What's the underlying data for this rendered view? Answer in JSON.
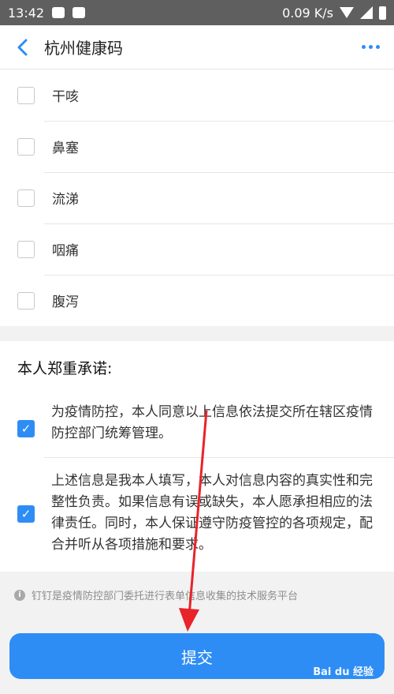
{
  "status_bar": {
    "time": "13:42",
    "speed": "0.09 K/s"
  },
  "nav": {
    "title": "杭州健康码"
  },
  "symptoms": [
    {
      "label": "干咳",
      "checked": false
    },
    {
      "label": "鼻塞",
      "checked": false
    },
    {
      "label": "流涕",
      "checked": false
    },
    {
      "label": "咽痛",
      "checked": false
    },
    {
      "label": "腹泻",
      "checked": false
    }
  ],
  "promise": {
    "title": "本人郑重承诺:",
    "items": [
      {
        "text": "为疫情防控，本人同意以上信息依法提交所在辖区疫情防控部门统筹管理。",
        "checked": true
      },
      {
        "text": "上述信息是我本人填写，本人对信息内容的真实性和完整性负责。如果信息有误或缺失，本人愿承担相应的法律责任。同时，本人保证遵守防疫管控的各项规定，配合并听从各项措施和要求。",
        "checked": true
      }
    ]
  },
  "info_text": "钉钉是疫情防控部门委托进行表单信息收集的技术服务平台",
  "submit_label": "提交",
  "watermark": "Bai du 经验",
  "colors": {
    "accent": "#2e8df5",
    "arrow": "#e8232a"
  }
}
